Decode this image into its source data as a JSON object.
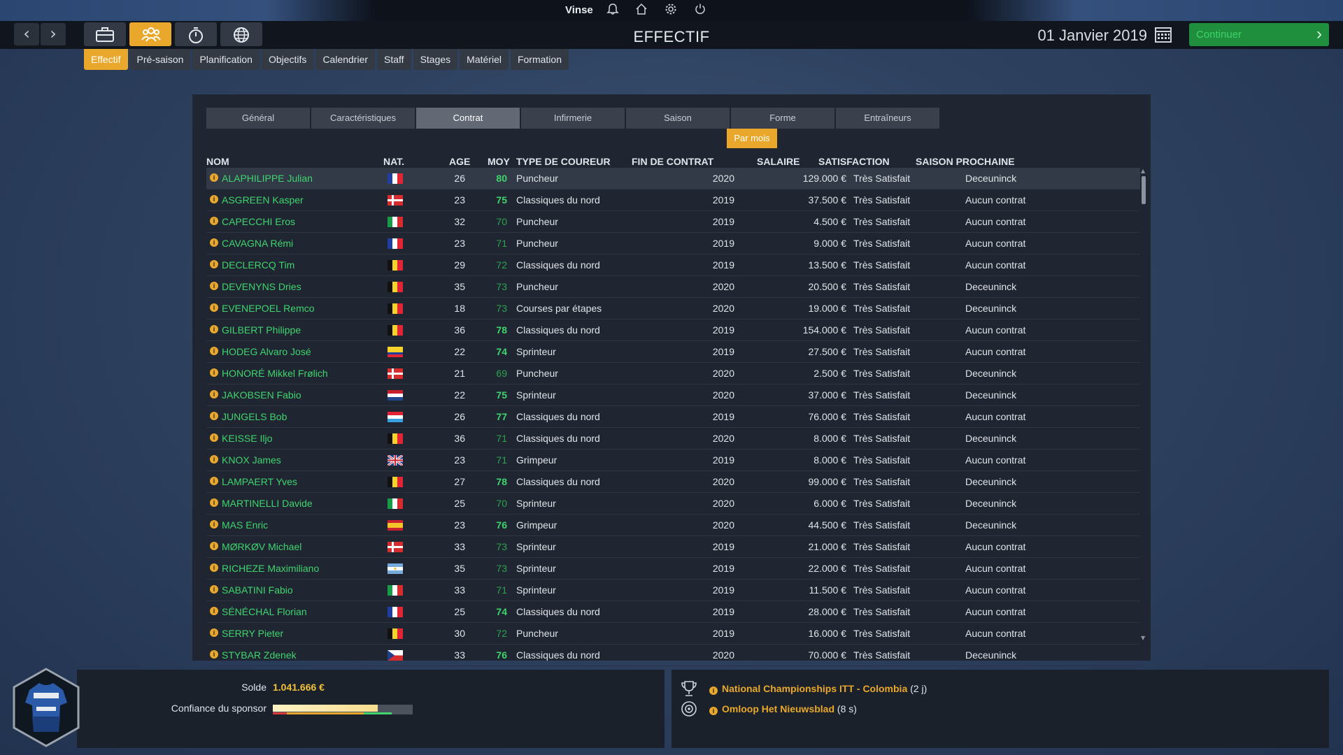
{
  "topbar": {
    "user": "Vinse"
  },
  "header": {
    "title": "EFFECTIF",
    "date": "01 Janvier 2019",
    "continue_label": "Continuer"
  },
  "subtabs": [
    "Effectif",
    "Pré-saison",
    "Planification",
    "Objectifs",
    "Calendrier",
    "Staff",
    "Stages",
    "Matériel",
    "Formation"
  ],
  "panel_tabs": [
    "Général",
    "Caractéristiques",
    "Contrat",
    "Infirmerie",
    "Saison",
    "Forme",
    "Entraîneurs"
  ],
  "active_panel_tab": "Contrat",
  "par_mois": "Par mois",
  "columns": {
    "nom": "NOM",
    "nat": "NAT.",
    "age": "AGE",
    "moy": "MOY",
    "type": "TYPE DE COUREUR",
    "fin": "FIN DE CONTRAT",
    "salaire": "SALAIRE",
    "satisfaction": "SATISFACTION",
    "saison": "SAISON PROCHAINE"
  },
  "riders": [
    {
      "name": "ALAPHILIPPE Julian",
      "nat": "FR",
      "age": "26",
      "moy": "80",
      "type": "Puncheur",
      "fin": "2020",
      "salaire": "129.000 €",
      "satisfaction": "Très Satisfait",
      "saison": "Deceuninck"
    },
    {
      "name": "ASGREEN Kasper",
      "nat": "DK",
      "age": "23",
      "moy": "75",
      "type": "Classiques du nord",
      "fin": "2019",
      "salaire": "37.500 €",
      "satisfaction": "Très Satisfait",
      "saison": "Aucun contrat"
    },
    {
      "name": "CAPECCHI Eros",
      "nat": "IT",
      "age": "32",
      "moy": "70",
      "type": "Puncheur",
      "fin": "2019",
      "salaire": "4.500 €",
      "satisfaction": "Très Satisfait",
      "saison": "Aucun contrat"
    },
    {
      "name": "CAVAGNA Rémi",
      "nat": "FR",
      "age": "23",
      "moy": "71",
      "type": "Puncheur",
      "fin": "2019",
      "salaire": "9.000 €",
      "satisfaction": "Très Satisfait",
      "saison": "Aucun contrat"
    },
    {
      "name": "DECLERCQ Tim",
      "nat": "BE",
      "age": "29",
      "moy": "72",
      "type": "Classiques du nord",
      "fin": "2019",
      "salaire": "13.500 €",
      "satisfaction": "Très Satisfait",
      "saison": "Aucun contrat"
    },
    {
      "name": "DEVENYNS Dries",
      "nat": "BE",
      "age": "35",
      "moy": "73",
      "type": "Puncheur",
      "fin": "2020",
      "salaire": "20.500 €",
      "satisfaction": "Très Satisfait",
      "saison": "Deceuninck"
    },
    {
      "name": "EVENEPOEL Remco",
      "nat": "BE",
      "age": "18",
      "moy": "73",
      "type": "Courses par étapes",
      "fin": "2020",
      "salaire": "19.000 €",
      "satisfaction": "Très Satisfait",
      "saison": "Deceuninck"
    },
    {
      "name": "GILBERT Philippe",
      "nat": "BE",
      "age": "36",
      "moy": "78",
      "type": "Classiques du nord",
      "fin": "2019",
      "salaire": "154.000 €",
      "satisfaction": "Très Satisfait",
      "saison": "Aucun contrat"
    },
    {
      "name": "HODEG Alvaro José",
      "nat": "CO",
      "age": "22",
      "moy": "74",
      "type": "Sprinteur",
      "fin": "2019",
      "salaire": "27.500 €",
      "satisfaction": "Très Satisfait",
      "saison": "Aucun contrat"
    },
    {
      "name": "HONORÉ Mikkel Frølich",
      "nat": "DK",
      "age": "21",
      "moy": "69",
      "type": "Puncheur",
      "fin": "2020",
      "salaire": "2.500 €",
      "satisfaction": "Très Satisfait",
      "saison": "Deceuninck"
    },
    {
      "name": "JAKOBSEN Fabio",
      "nat": "NL",
      "age": "22",
      "moy": "75",
      "type": "Sprinteur",
      "fin": "2020",
      "salaire": "37.000 €",
      "satisfaction": "Très Satisfait",
      "saison": "Deceuninck"
    },
    {
      "name": "JUNGELS Bob",
      "nat": "LU",
      "age": "26",
      "moy": "77",
      "type": "Classiques du nord",
      "fin": "2019",
      "salaire": "76.000 €",
      "satisfaction": "Très Satisfait",
      "saison": "Aucun contrat"
    },
    {
      "name": "KEISSE Iljo",
      "nat": "BE",
      "age": "36",
      "moy": "71",
      "type": "Classiques du nord",
      "fin": "2020",
      "salaire": "8.000 €",
      "satisfaction": "Très Satisfait",
      "saison": "Deceuninck"
    },
    {
      "name": "KNOX James",
      "nat": "GB",
      "age": "23",
      "moy": "71",
      "type": "Grimpeur",
      "fin": "2019",
      "salaire": "8.000 €",
      "satisfaction": "Très Satisfait",
      "saison": "Aucun contrat"
    },
    {
      "name": "LAMPAERT Yves",
      "nat": "BE",
      "age": "27",
      "moy": "78",
      "type": "Classiques du nord",
      "fin": "2020",
      "salaire": "99.000 €",
      "satisfaction": "Très Satisfait",
      "saison": "Deceuninck"
    },
    {
      "name": "MARTINELLI Davide",
      "nat": "IT",
      "age": "25",
      "moy": "70",
      "type": "Sprinteur",
      "fin": "2020",
      "salaire": "6.000 €",
      "satisfaction": "Très Satisfait",
      "saison": "Deceuninck"
    },
    {
      "name": "MAS Enric",
      "nat": "ES",
      "age": "23",
      "moy": "76",
      "type": "Grimpeur",
      "fin": "2020",
      "salaire": "44.500 €",
      "satisfaction": "Très Satisfait",
      "saison": "Deceuninck"
    },
    {
      "name": "MØRKØV Michael",
      "nat": "DK",
      "age": "33",
      "moy": "73",
      "type": "Sprinteur",
      "fin": "2019",
      "salaire": "21.000 €",
      "satisfaction": "Très Satisfait",
      "saison": "Aucun contrat"
    },
    {
      "name": "RICHEZE Maximiliano",
      "nat": "AR",
      "age": "35",
      "moy": "73",
      "type": "Sprinteur",
      "fin": "2019",
      "salaire": "22.000 €",
      "satisfaction": "Très Satisfait",
      "saison": "Aucun contrat"
    },
    {
      "name": "SABATINI Fabio",
      "nat": "IT",
      "age": "33",
      "moy": "71",
      "type": "Sprinteur",
      "fin": "2019",
      "salaire": "11.500 €",
      "satisfaction": "Très Satisfait",
      "saison": "Aucun contrat"
    },
    {
      "name": "SÉNÉCHAL Florian",
      "nat": "FR",
      "age": "25",
      "moy": "74",
      "type": "Classiques du nord",
      "fin": "2019",
      "salaire": "28.000 €",
      "satisfaction": "Très Satisfait",
      "saison": "Aucun contrat"
    },
    {
      "name": "SERRY Pieter",
      "nat": "BE",
      "age": "30",
      "moy": "72",
      "type": "Puncheur",
      "fin": "2019",
      "salaire": "16.000 €",
      "satisfaction": "Très Satisfait",
      "saison": "Aucun contrat"
    },
    {
      "name": "STYBAR Zdenek",
      "nat": "CZ",
      "age": "33",
      "moy": "76",
      "type": "Classiques du nord",
      "fin": "2020",
      "salaire": "70.000 €",
      "satisfaction": "Très Satisfait",
      "saison": "Deceuninck"
    }
  ],
  "bottom": {
    "solde_label": "Solde",
    "solde_value": "1.041.666 €",
    "confiance_label": "Confiance du sponsor",
    "confiance_level": 0.75
  },
  "races": [
    {
      "name": "National Championships ITT - Colombia",
      "time": "(2 j)",
      "icon": "trophy-icon"
    },
    {
      "name": "Omloop Het Nieuwsblad",
      "time": "(8 s)",
      "icon": "target-icon"
    }
  ],
  "colors": {
    "accent": "#e9a82b",
    "green": "#3fd46e",
    "continue": "#1f8f3e"
  }
}
